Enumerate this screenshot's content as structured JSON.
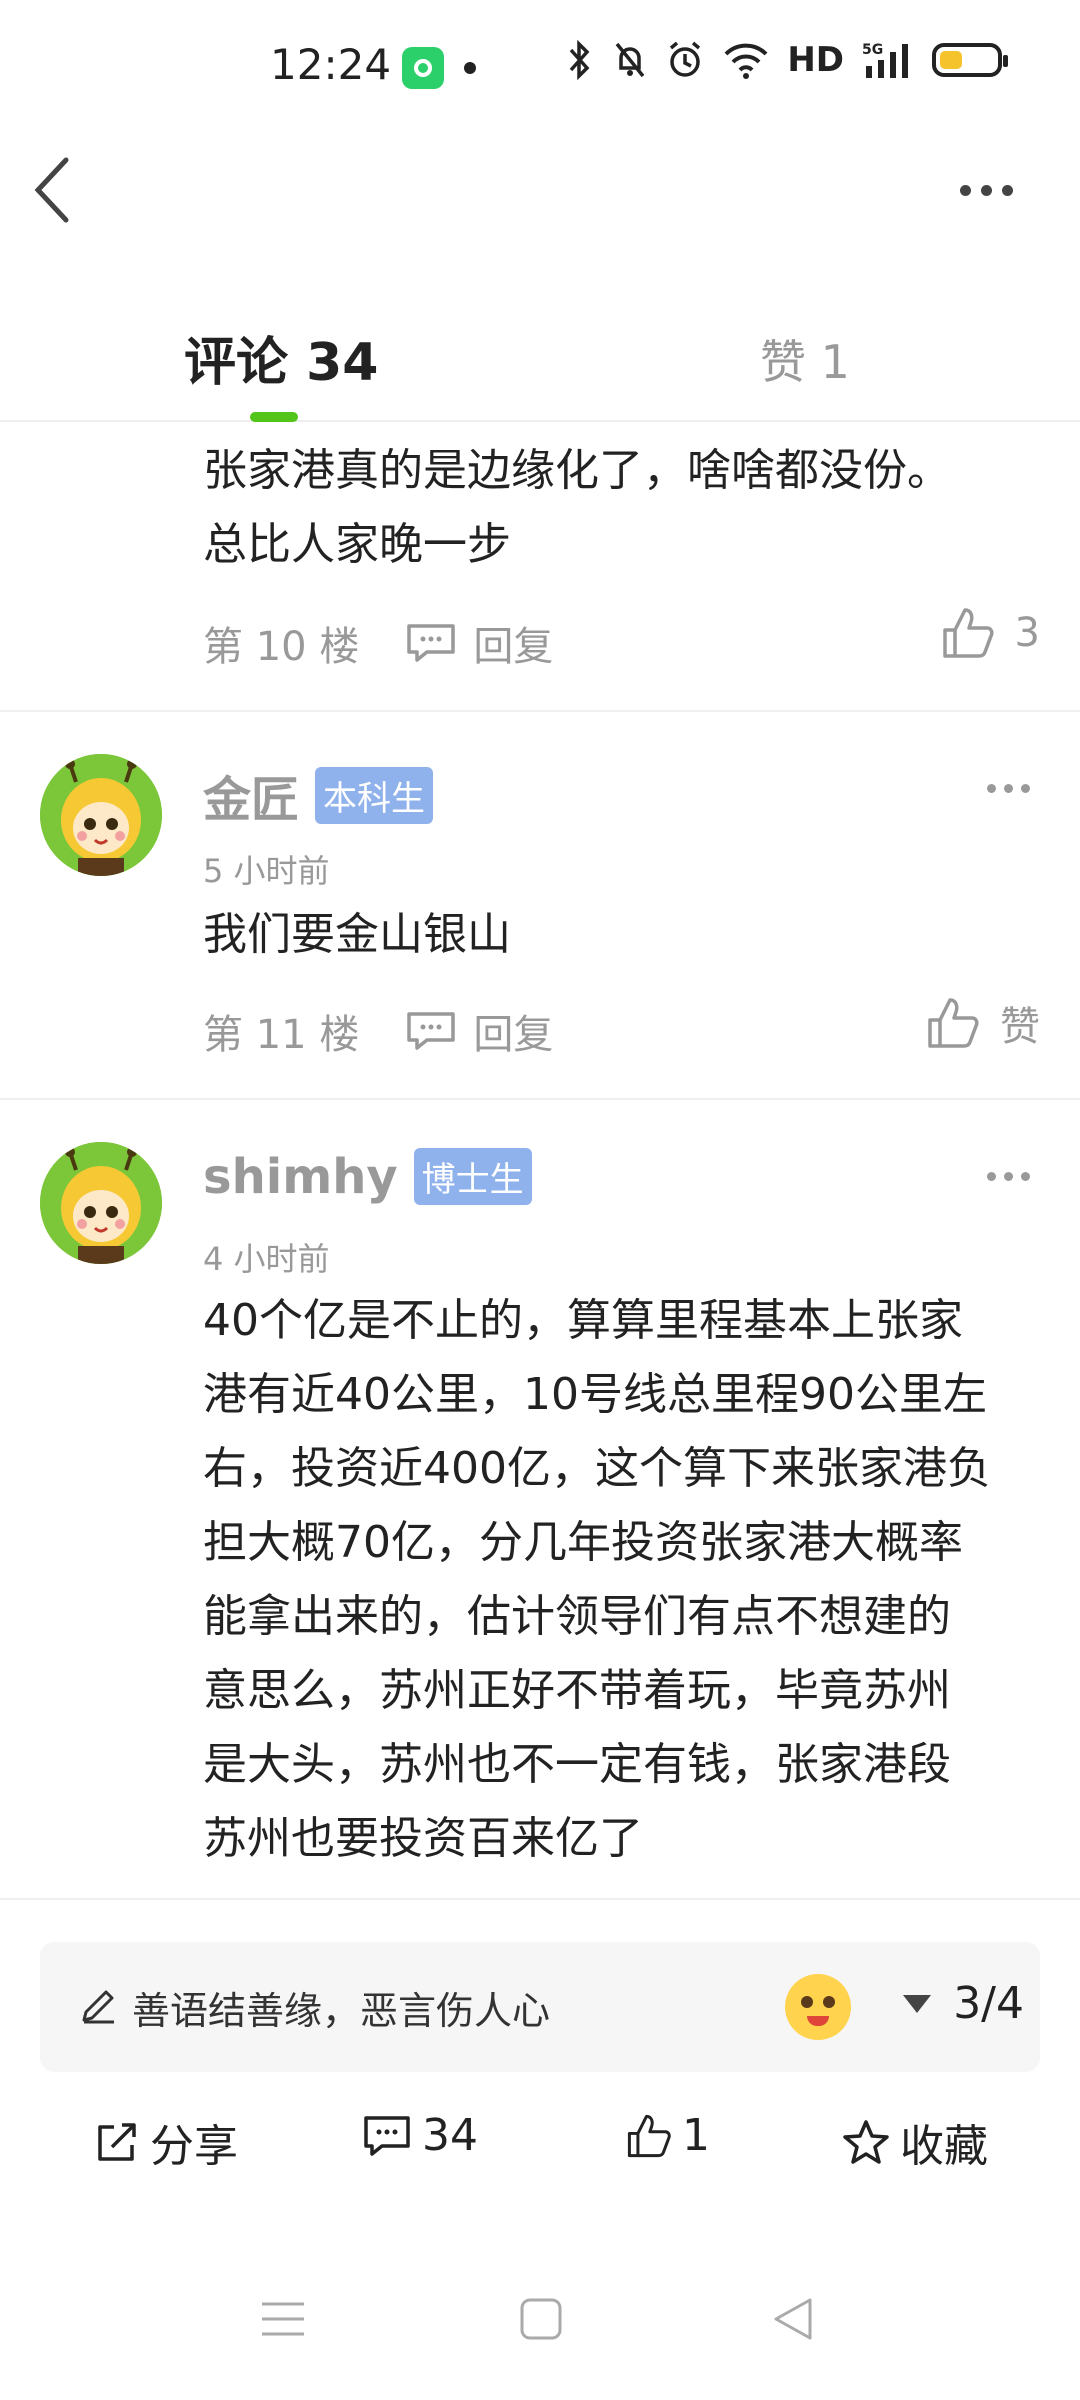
{
  "status_bar": {
    "time": "12:24",
    "network": "HD",
    "signal": "5G"
  },
  "tabs": {
    "comments": "评论 34",
    "likes": "赞 1"
  },
  "comments": [
    {
      "text_line1": "张家港真的是边缘化了，啥啥都没份。",
      "text_line2": "总比人家晚一步",
      "floor": "第 10 楼",
      "reply_label": "回复",
      "like_count": "3"
    },
    {
      "author": "金匠",
      "badge": "本科生",
      "time": "5 小时前",
      "text": "我们要金山银山",
      "floor": "第 11 楼",
      "reply_label": "回复",
      "like_label": "赞"
    },
    {
      "author": "shimhy",
      "badge": "博士生",
      "time": "4 小时前",
      "lines": [
        "40个亿是不止的，算算里程基本上张家",
        "港有近40公里，10号线总里程90公里左",
        "右，投资近400亿，这个算下来张家港负",
        "担大概70亿，分几年投资张家港大概率",
        "能拿出来的，估计领导们有点不想建的",
        "意思么，苏州正好不带着玩，毕竟苏州",
        "是大头，苏州也不一定有钱，张家港段",
        "苏州也要投资百来亿了"
      ]
    }
  ],
  "input": {
    "placeholder": "善语结善缘，恶言伤人心",
    "page": "3/4"
  },
  "actions": {
    "share": "分享",
    "comments": "34",
    "likes": "1",
    "favorite": "收藏"
  },
  "colors": {
    "accent": "#52c41a",
    "badge": "#8fb2ec",
    "muted": "#999999"
  }
}
